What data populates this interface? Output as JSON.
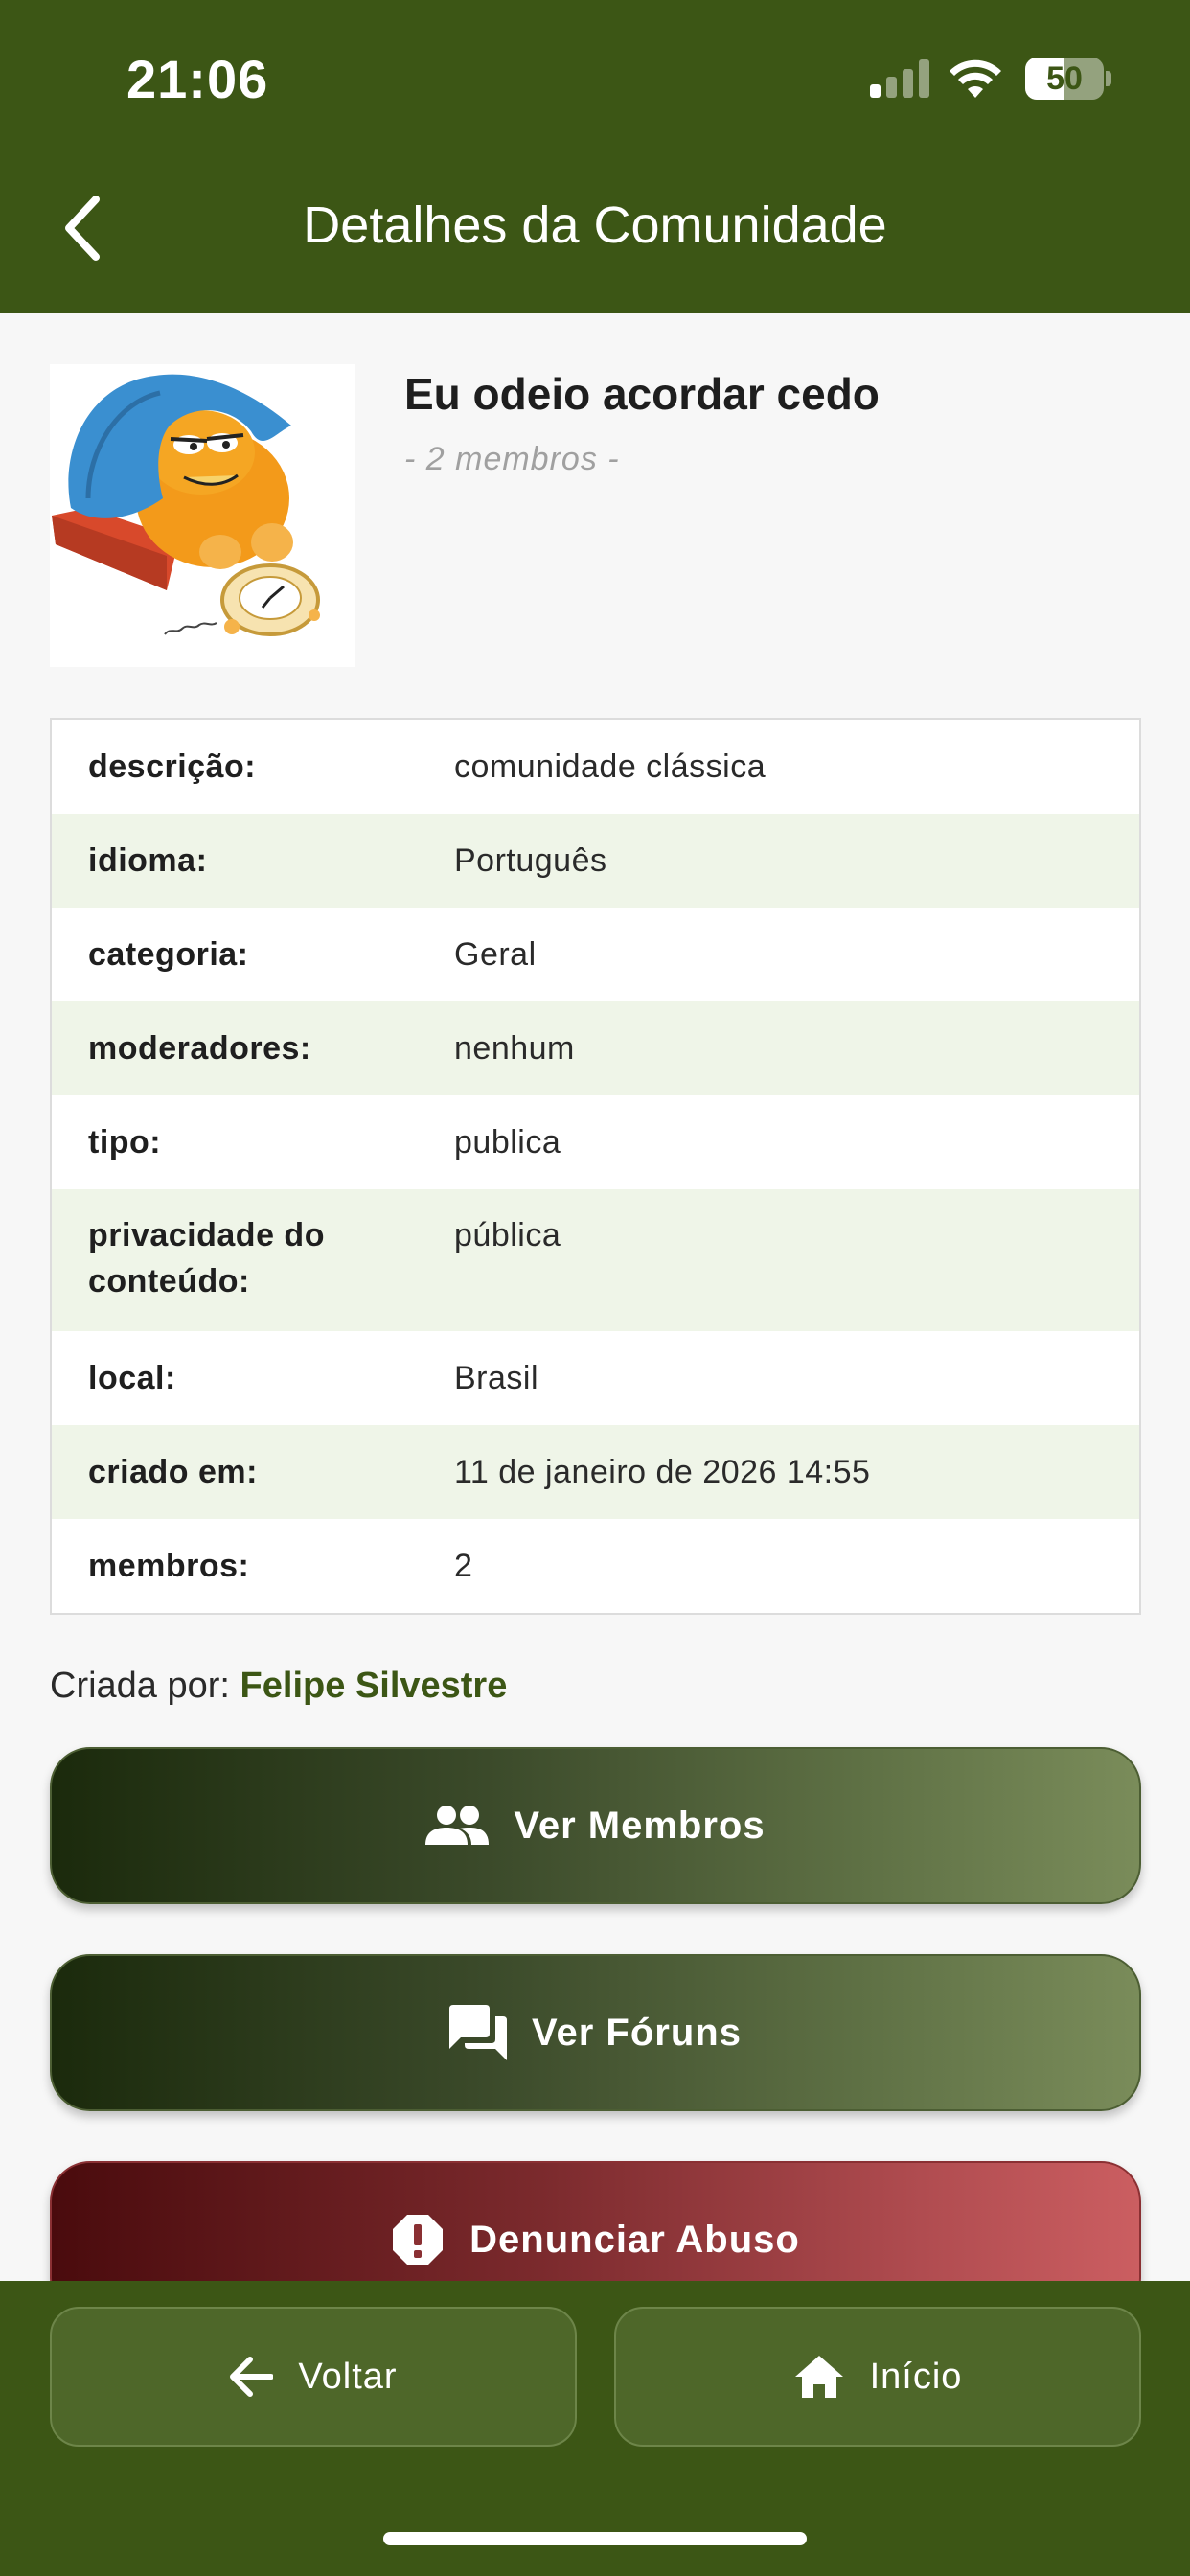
{
  "status_bar": {
    "time": "21:06",
    "battery": "50",
    "battery_level": 0.5,
    "signal_bars_active": 1,
    "signal_bars_total": 4
  },
  "header": {
    "title": "Detalhes da Comunidade",
    "back_icon": "chevron-left-icon"
  },
  "community": {
    "name": "Eu odeio acordar cedo",
    "members_caption": "- 2 membros -"
  },
  "details": [
    {
      "label": "descrição:",
      "value": "comunidade clássica"
    },
    {
      "label": "idioma:",
      "value": "Português"
    },
    {
      "label": "categoria:",
      "value": "Geral"
    },
    {
      "label": "moderadores:",
      "value": "nenhum"
    },
    {
      "label": "tipo:",
      "value": "publica"
    },
    {
      "label": "privacidade do conteúdo:",
      "value": "pública"
    },
    {
      "label": "local:",
      "value": "Brasil"
    },
    {
      "label": "criado em:",
      "value": "11 de janeiro de 2026 14:55"
    },
    {
      "label": "membros:",
      "value": "2"
    }
  ],
  "creator": {
    "prefix": "Criada por:",
    "name": "Felipe Silvestre"
  },
  "actions": {
    "members": {
      "label": "Ver Membros",
      "icon": "people-icon"
    },
    "forums": {
      "label": "Ver Fóruns",
      "icon": "forum-icon"
    },
    "report": {
      "label": "Denunciar Abuso",
      "icon": "alert-icon"
    }
  },
  "bottom_nav": {
    "back": {
      "label": "Voltar",
      "icon": "arrow-left-icon"
    },
    "home": {
      "label": "Início",
      "icon": "home-icon"
    }
  },
  "colors": {
    "brand": "#3c5615",
    "row_alt": "#eff5e8",
    "danger": "#b04c50"
  }
}
